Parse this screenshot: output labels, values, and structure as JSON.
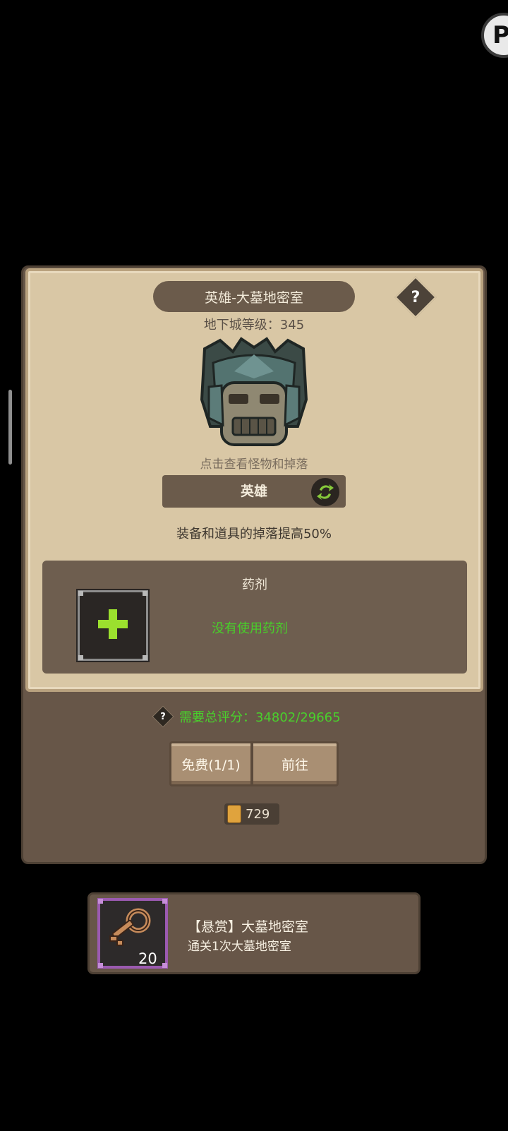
{
  "corner_button": {
    "icon": "p-logo-icon"
  },
  "dungeon": {
    "title": "英雄-大墓地密室",
    "level_text": "地下城等级：345",
    "monster_hint": "点击查看怪物和掉落",
    "difficulty": "英雄",
    "drop_bonus": "装备和道具的掉落提高50%"
  },
  "potion": {
    "title": "药剂",
    "empty_text": "没有使用药剂"
  },
  "requirement": {
    "text": "需要总评分：34802/29665",
    "color": "#49d12c"
  },
  "actions": {
    "free_label": "免费(1/1)",
    "go_label": "前往"
  },
  "currency": {
    "value": "729",
    "icon": "scroll-icon"
  },
  "quest": {
    "title": "【悬赏】大墓地密室",
    "description": "通关1次大墓地密室",
    "reward_count": "20",
    "reward_icon": "key-icon"
  }
}
